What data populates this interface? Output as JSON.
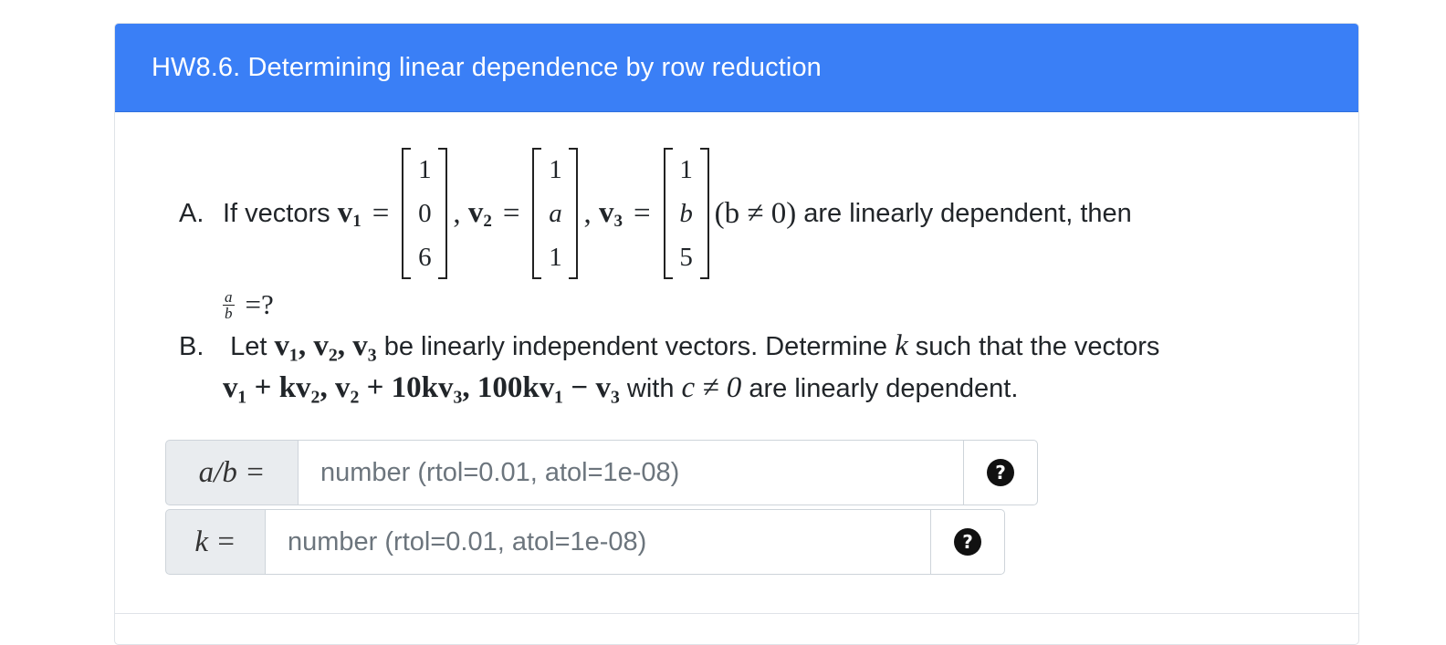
{
  "header": {
    "title": "HW8.6. Determining linear dependence by row reduction"
  },
  "partA": {
    "label": "A.",
    "intro": "If vectors",
    "v1_symbol": "v",
    "v1_sub": "1",
    "v1": [
      "1",
      "0",
      "6"
    ],
    "v2_symbol": "v",
    "v2_sub": "2",
    "v2": [
      "1",
      "a",
      "1"
    ],
    "v3_symbol": "v",
    "v3_sub": "3",
    "v3": [
      "1",
      "b",
      "5"
    ],
    "condition": "(b ≠ 0)",
    "outro": "are linearly dependent, then",
    "frac_num": "a",
    "frac_den": "b",
    "question": "=?"
  },
  "partB": {
    "label": "B.",
    "text1": "Let",
    "vectors": "v₁, v₂, v₃",
    "text2": "be linearly independent vectors. Determine",
    "k": "k",
    "text3": "such that the vectors",
    "expr": "v₁ + kv₂, v₂ + 10kv₃, 100kv₁ − v₃",
    "text4": "with",
    "cond": "c ≠ 0",
    "text5": "are linearly dependent."
  },
  "inputs": [
    {
      "label": "a/b =",
      "placeholder": "number (rtol=0.01, atol=1e-08)",
      "value": "",
      "help_icon": "question-circle-icon"
    },
    {
      "label": "k =",
      "placeholder": "number (rtol=0.01, atol=1e-08)",
      "value": "",
      "help_icon": "question-circle-icon"
    }
  ],
  "colors": {
    "header_bg": "#3a7ff6",
    "prefix_bg": "#e9ecef"
  }
}
